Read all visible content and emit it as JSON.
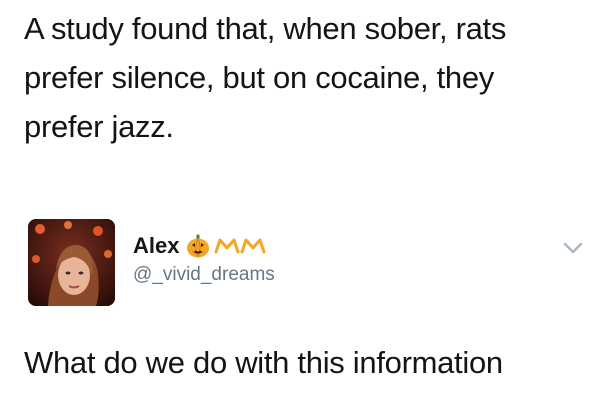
{
  "quote": {
    "lines": [
      "A study found that, when sober, rats",
      "prefer silence, but on cocaine, they",
      "prefer jazz."
    ]
  },
  "tweet": {
    "display_name": "Alex",
    "handle": "@_vivid_dreams",
    "name_emojis": [
      "pumpkin-icon",
      "crown-icon",
      "crown-icon"
    ],
    "text": "What do we do with this information"
  },
  "colors": {
    "text": "#141414",
    "handle": "#657786",
    "accent_emoji": "#f5a623",
    "chevron": "#aab8c2"
  }
}
